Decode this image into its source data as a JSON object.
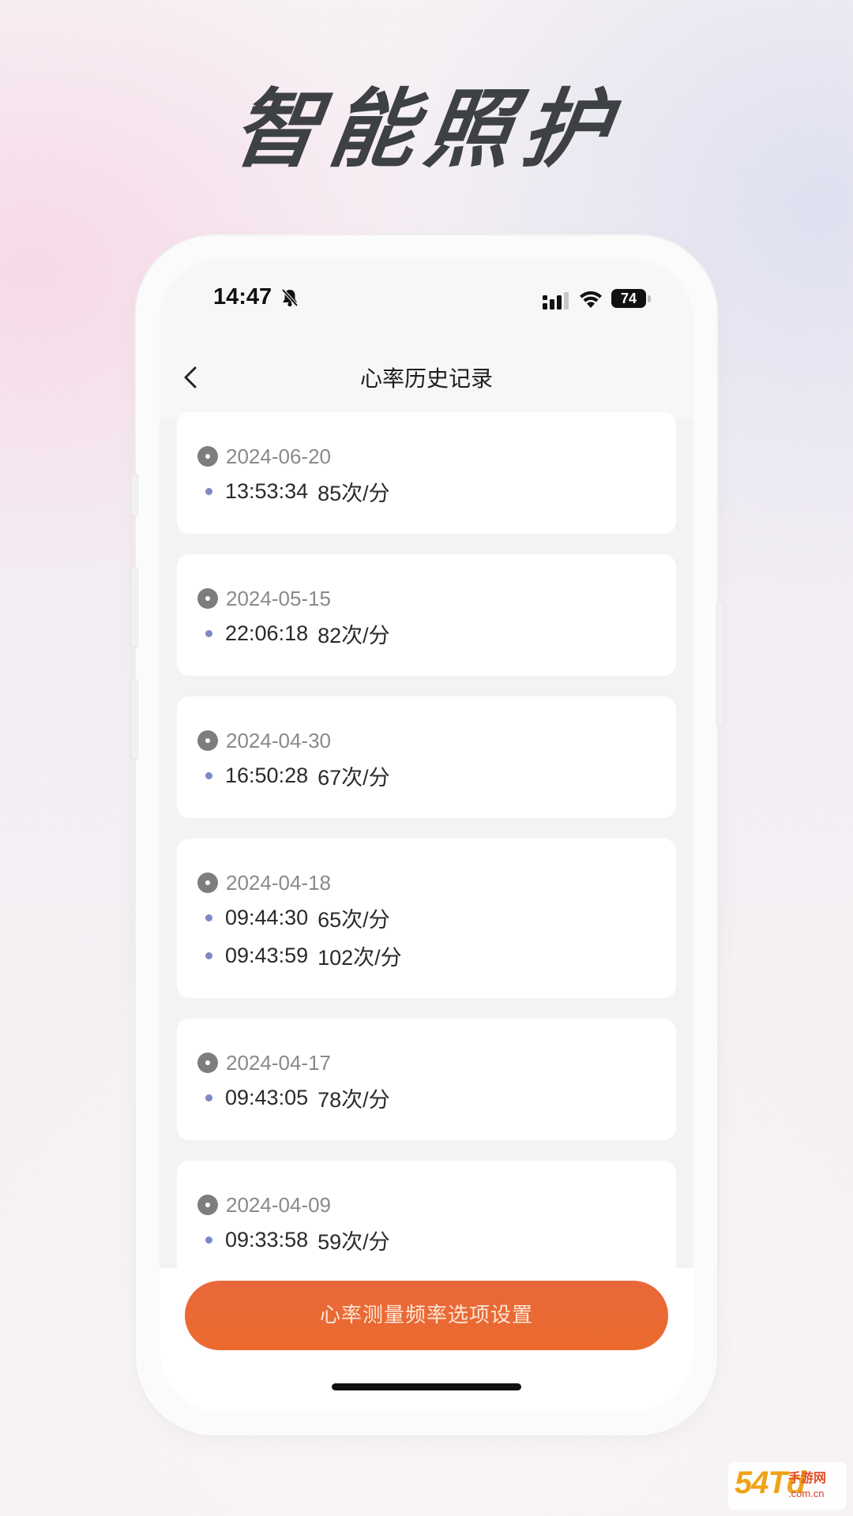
{
  "headline": "智能照护",
  "status_bar": {
    "time": "14:47",
    "battery": "74",
    "icons": [
      "bell-slash-icon",
      "signal-icon",
      "wifi-icon",
      "battery-icon"
    ]
  },
  "nav": {
    "title": "心率历史记录",
    "back_icon": "chevron-left-icon"
  },
  "records": [
    {
      "date": "2024-06-20",
      "entries": [
        {
          "time": "13:53:34",
          "rate": "85次/分"
        }
      ]
    },
    {
      "date": "2024-05-15",
      "entries": [
        {
          "time": "22:06:18",
          "rate": "82次/分"
        }
      ]
    },
    {
      "date": "2024-04-30",
      "entries": [
        {
          "time": "16:50:28",
          "rate": "67次/分"
        }
      ]
    },
    {
      "date": "2024-04-18",
      "entries": [
        {
          "time": "09:44:30",
          "rate": "65次/分"
        },
        {
          "time": "09:43:59",
          "rate": "102次/分"
        }
      ]
    },
    {
      "date": "2024-04-17",
      "entries": [
        {
          "time": "09:43:05",
          "rate": "78次/分"
        }
      ]
    },
    {
      "date": "2024-04-09",
      "entries": [
        {
          "time": "09:33:58",
          "rate": "59次/分"
        }
      ]
    }
  ],
  "settings_button": "心率测量频率选项设置",
  "watermark": {
    "main": "54Td",
    "sub": "手游网",
    "url": ".com.cn"
  },
  "colors": {
    "accent": "#ec6a2e",
    "entry_dot": "#7e89c2",
    "headline": "#3e4143"
  }
}
